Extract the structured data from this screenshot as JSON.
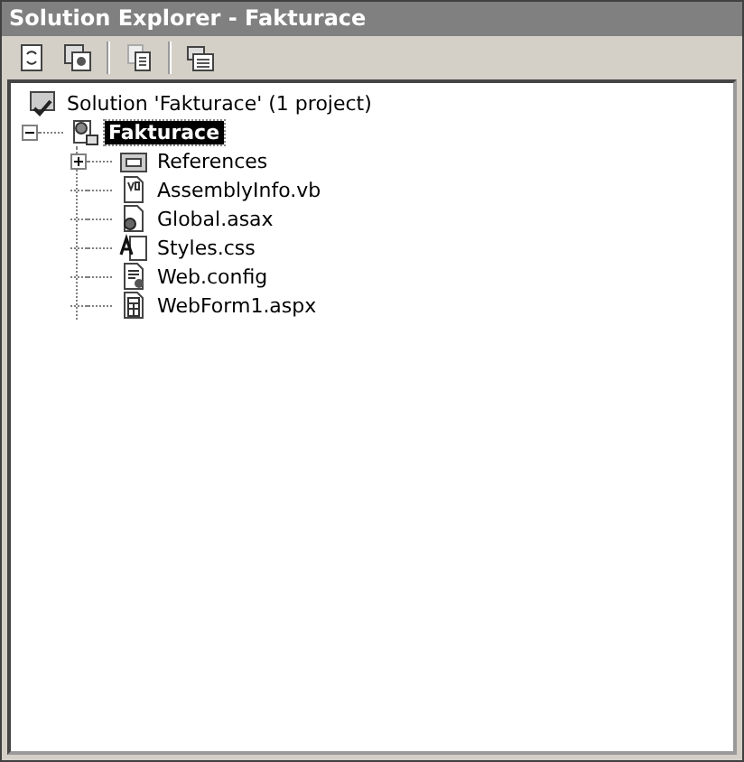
{
  "window": {
    "title": "Solution Explorer - Fakturace"
  },
  "toolbar": [
    {
      "kind": "refresh"
    },
    {
      "kind": "copy-project"
    },
    {
      "kind": "show-all"
    },
    {
      "kind": "properties"
    }
  ],
  "tree": [
    {
      "label": "Solution 'Fakturace' (1 project)",
      "selected": false,
      "children": [
        {
          "label": "Fakturace",
          "selected": true,
          "expanded": true,
          "children": [
            {
              "label": "References",
              "kind": "references",
              "selected": false,
              "expanded": false
            },
            {
              "label": "AssemblyInfo.vb",
              "kind": "vb",
              "selected": false
            },
            {
              "label": "Global.asax",
              "kind": "asax",
              "selected": false
            },
            {
              "label": "Styles.css",
              "kind": "css",
              "selected": false
            },
            {
              "label": "Web.config",
              "kind": "config",
              "selected": false
            },
            {
              "label": "WebForm1.aspx",
              "kind": "aspx",
              "selected": false
            }
          ]
        }
      ]
    }
  ]
}
